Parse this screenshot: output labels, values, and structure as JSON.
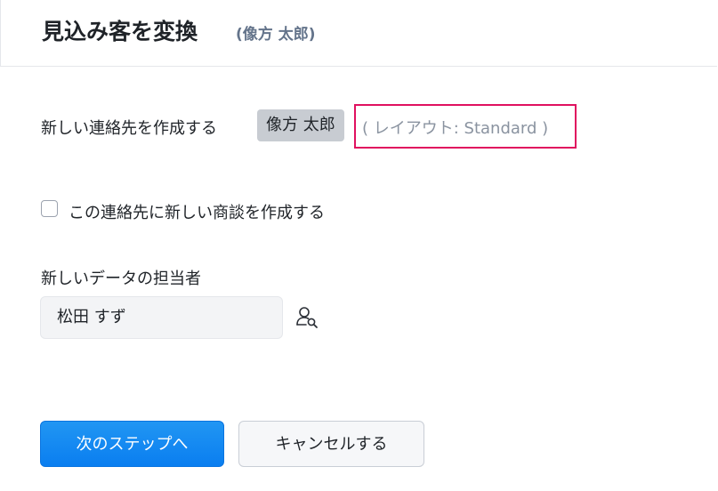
{
  "header": {
    "title": "見込み客を変換",
    "subtitle": "(像方 太郎)"
  },
  "contact": {
    "label": "新しい連絡先を作成する",
    "name": "像方 太郎",
    "layout_text": "( レイアウト: Standard )"
  },
  "deal": {
    "label": "この連絡先に新しい商談を作成する",
    "checked": false
  },
  "owner": {
    "label": "新しいデータの担当者",
    "value": "松田 すず",
    "icon": "person-search-icon"
  },
  "buttons": {
    "next": "次のステップへ",
    "cancel": "キャンセルする"
  },
  "colors": {
    "accent": "#0a7ef0",
    "highlight": "#e0115f"
  }
}
